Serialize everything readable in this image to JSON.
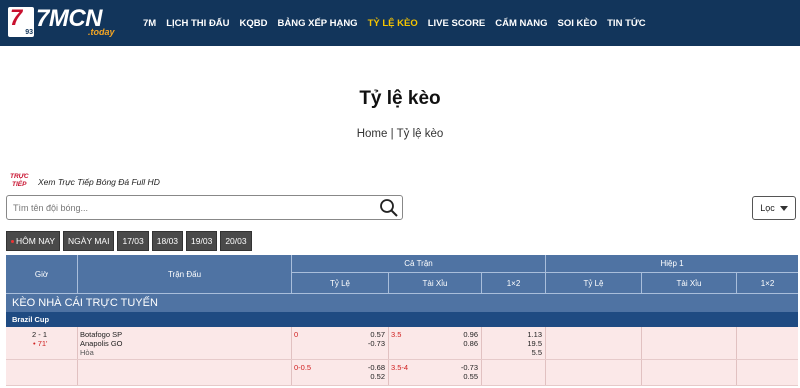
{
  "logo": {
    "mark": "7",
    "mark_num": "93",
    "name": "7MCN",
    "suffix": ".today"
  },
  "nav": [
    {
      "label": "7M",
      "active": false
    },
    {
      "label": "LỊCH THI ĐẤU",
      "active": false
    },
    {
      "label": "KQBD",
      "active": false
    },
    {
      "label": "BẢNG XẾP HẠNG",
      "active": false
    },
    {
      "label": "TỶ LỆ KÈO",
      "active": true
    },
    {
      "label": "LIVE SCORE",
      "active": false
    },
    {
      "label": "CẨM NANG",
      "active": false
    },
    {
      "label": "SOI KÈO",
      "active": false
    },
    {
      "label": "TIN TỨC",
      "active": false
    }
  ],
  "page": {
    "title": "Tỷ lệ kèo",
    "breadcrumb_home": "Home",
    "breadcrumb_sep": "|",
    "breadcrumb_current": "Tỷ lệ kèo"
  },
  "live": {
    "badge_line1": "TRỰC",
    "badge_line2": "TIẾP",
    "text": "Xem Trực Tiếp Bóng Đá Full HD"
  },
  "search": {
    "placeholder": "Tìm tên đội bóng...",
    "value": ""
  },
  "filter": {
    "label": "Lọc"
  },
  "dates": [
    "HÔM NAY",
    "NGÀY MAI",
    "17/03",
    "18/03",
    "19/03",
    "20/03"
  ],
  "table": {
    "col_time": "Giờ",
    "col_match": "Trận Đấu",
    "group_fulltime": "Cả Trận",
    "group_half": "Hiệp 1",
    "sub_handicap": "Tỷ Lệ",
    "sub_ou": "Tài Xỉu",
    "sub_1x2": "1×2",
    "section": "KÈO NHÀ CÁI TRỰC TUYẾN",
    "league": "Brazil Cup",
    "match": {
      "score": "2 - 1",
      "minute": "71'",
      "home": "Botafogo SP",
      "away": "Anapolis GO",
      "draw": "Hòa",
      "hdp_line": "0",
      "hdp_home": "0.57",
      "hdp_away": "-0.73",
      "ou_line": "3.5",
      "ou_over": "0.96",
      "ou_under": "0.86",
      "x12_home": "1.13",
      "x12_away": "19.5",
      "x12_draw": "5.5"
    },
    "match_alt": {
      "hdp_line": "0-0.5",
      "hdp_home": "-0.68",
      "hdp_away": "0.52",
      "ou_line": "3.5-4",
      "ou_over": "-0.73",
      "ou_under": "0.55"
    }
  }
}
